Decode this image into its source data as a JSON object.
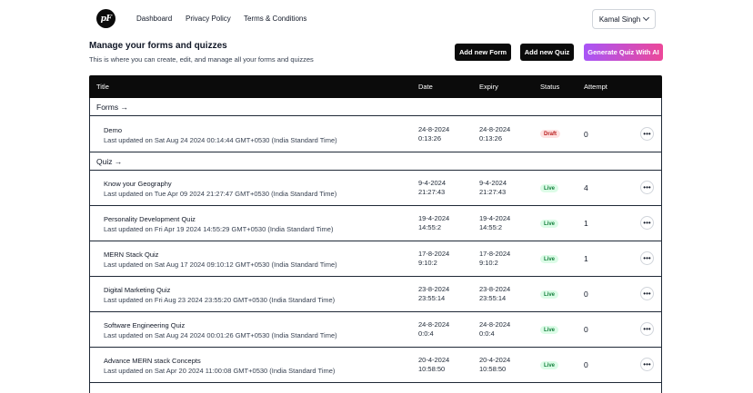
{
  "nav": {
    "logo": "pF",
    "links": [
      "Dashboard",
      "Privacy Policy",
      "Terms & Conditions"
    ],
    "user": "Kamal Singh"
  },
  "header": {
    "title": "Manage your forms and quizzes",
    "subtitle": "This is where you can create, edit, and manage all your forms and quizzes",
    "buttons": {
      "add_form": "Add new Form",
      "add_quiz": "Add new Quiz",
      "generate_ai": "Generate Quiz With AI"
    }
  },
  "table": {
    "columns": [
      "Title",
      "Date",
      "Expiry",
      "Status",
      "Attempt"
    ],
    "forms_label": "Forms →",
    "quiz_label": "Quiz →",
    "forms": [
      {
        "name": "Demo",
        "updated": "Last updated on Sat Aug 24 2024 00:14:44 GMT+0530 (India Standard Time)",
        "date1": "24-8-2024",
        "date2": "0:13:26",
        "exp1": "24-8-2024",
        "exp2": "0:13:26",
        "status": "Draft",
        "attempt": "0"
      }
    ],
    "quizzes": [
      {
        "name": "Know your Geography",
        "updated": "Last updated on Tue Apr 09 2024 21:27:47 GMT+0530 (India Standard Time)",
        "date1": "9-4-2024",
        "date2": "21:27:43",
        "exp1": "9-4-2024",
        "exp2": "21:27:43",
        "status": "Live",
        "attempt": "4"
      },
      {
        "name": "Personality Development Quiz",
        "updated": "Last updated on Fri Apr 19 2024 14:55:29 GMT+0530 (India Standard Time)",
        "date1": "19-4-2024",
        "date2": "14:55:2",
        "exp1": "19-4-2024",
        "exp2": "14:55:2",
        "status": "Live",
        "attempt": "1"
      },
      {
        "name": "MERN Stack Quiz",
        "updated": "Last updated on Sat Aug 17 2024 09:10:12 GMT+0530 (India Standard Time)",
        "date1": "17-8-2024",
        "date2": "9:10:2",
        "exp1": "17-8-2024",
        "exp2": "9:10:2",
        "status": "Live",
        "attempt": "1"
      },
      {
        "name": "Digital Marketing Quiz",
        "updated": "Last updated on Fri Aug 23 2024 23:55:20 GMT+0530 (India Standard Time)",
        "date1": "23-8-2024",
        "date2": "23:55:14",
        "exp1": "23-8-2024",
        "exp2": "23:55:14",
        "status": "Live",
        "attempt": "0"
      },
      {
        "name": "Software Engineering Quiz",
        "updated": "Last updated on Sat Aug 24 2024 00:01:26 GMT+0530 (India Standard Time)",
        "date1": "24-8-2024",
        "date2": "0:0:4",
        "exp1": "24-8-2024",
        "exp2": "0:0:4",
        "status": "Live",
        "attempt": "0"
      },
      {
        "name": "Advance MERN stack Concepts",
        "updated": "Last updated on Sat Apr 20 2024 11:00:08 GMT+0530 (India Standard Time)",
        "date1": "20-4-2024",
        "date2": "10:58:50",
        "exp1": "20-4-2024",
        "exp2": "10:58:50",
        "status": "Live",
        "attempt": "0"
      }
    ]
  },
  "colors": {
    "primary": "#0b0b0b",
    "live_bg": "#dcfce7",
    "live_text": "#15803d",
    "draft_bg": "#fee2e2",
    "draft_text": "#b91c1c",
    "ai_gradient_start": "#a855f7",
    "ai_gradient_end": "#ec4899"
  }
}
